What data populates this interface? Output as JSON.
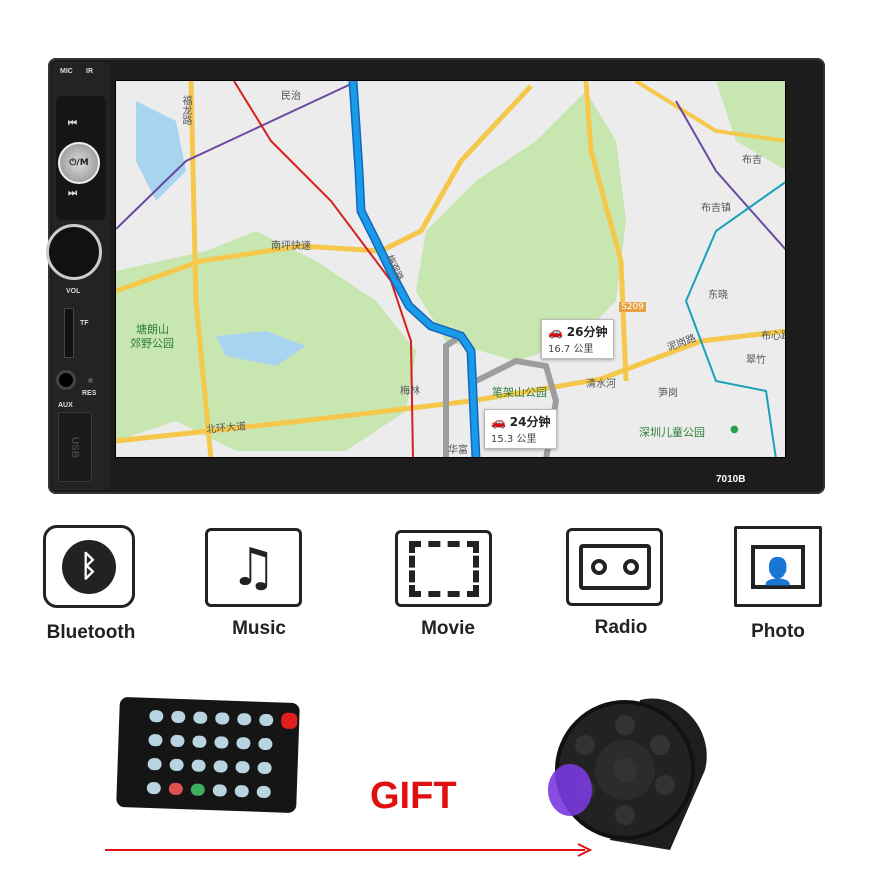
{
  "device": {
    "model": "7010B",
    "mic_label": "MIC",
    "ir_label": "IR",
    "mode_button": "⏻/M",
    "vol_label": "VOL",
    "tf_label": "TF",
    "res_label": "RES",
    "aux_label": "AUX",
    "usb_label": "USB"
  },
  "map": {
    "labels": {
      "minzhi": "民治",
      "fulong": "福龙路",
      "nanping": "南坪快速",
      "tanglang": "塘朗山",
      "tanglang2": "郊野公园",
      "beihuan": "北环大道",
      "meilin": "梅林",
      "huafu": "华富",
      "bijia": "笔架山公园",
      "qingshui": "清水河",
      "sungang": "笋岗",
      "children": "深圳儿童公园",
      "s209": "S209",
      "nigang": "泥岗路",
      "buxin": "布心路",
      "dongxiao": "东晓",
      "bujizhen": "布吉镇",
      "buji": "布吉",
      "cuizhu": "翠竹",
      "meiguan": "梅观路"
    },
    "routes": [
      {
        "time": "26分钟",
        "distance": "16.7 公里"
      },
      {
        "time": "24分钟",
        "distance": "15.3 公里"
      }
    ],
    "colors": {
      "route": "#1a9be8",
      "alt_route": "#9e9e9e",
      "road": "#f5c84c",
      "park": "#c8e6b0"
    }
  },
  "features": [
    {
      "label": "Bluetooth",
      "icon": "bluetooth-icon"
    },
    {
      "label": "Music",
      "icon": "music-note-icon"
    },
    {
      "label": "Movie",
      "icon": "film-icon"
    },
    {
      "label": "Radio",
      "icon": "radio-icon"
    },
    {
      "label": "Photo",
      "icon": "photo-icon"
    }
  ],
  "gift": {
    "text": "GIFT",
    "color": "#e01010"
  }
}
